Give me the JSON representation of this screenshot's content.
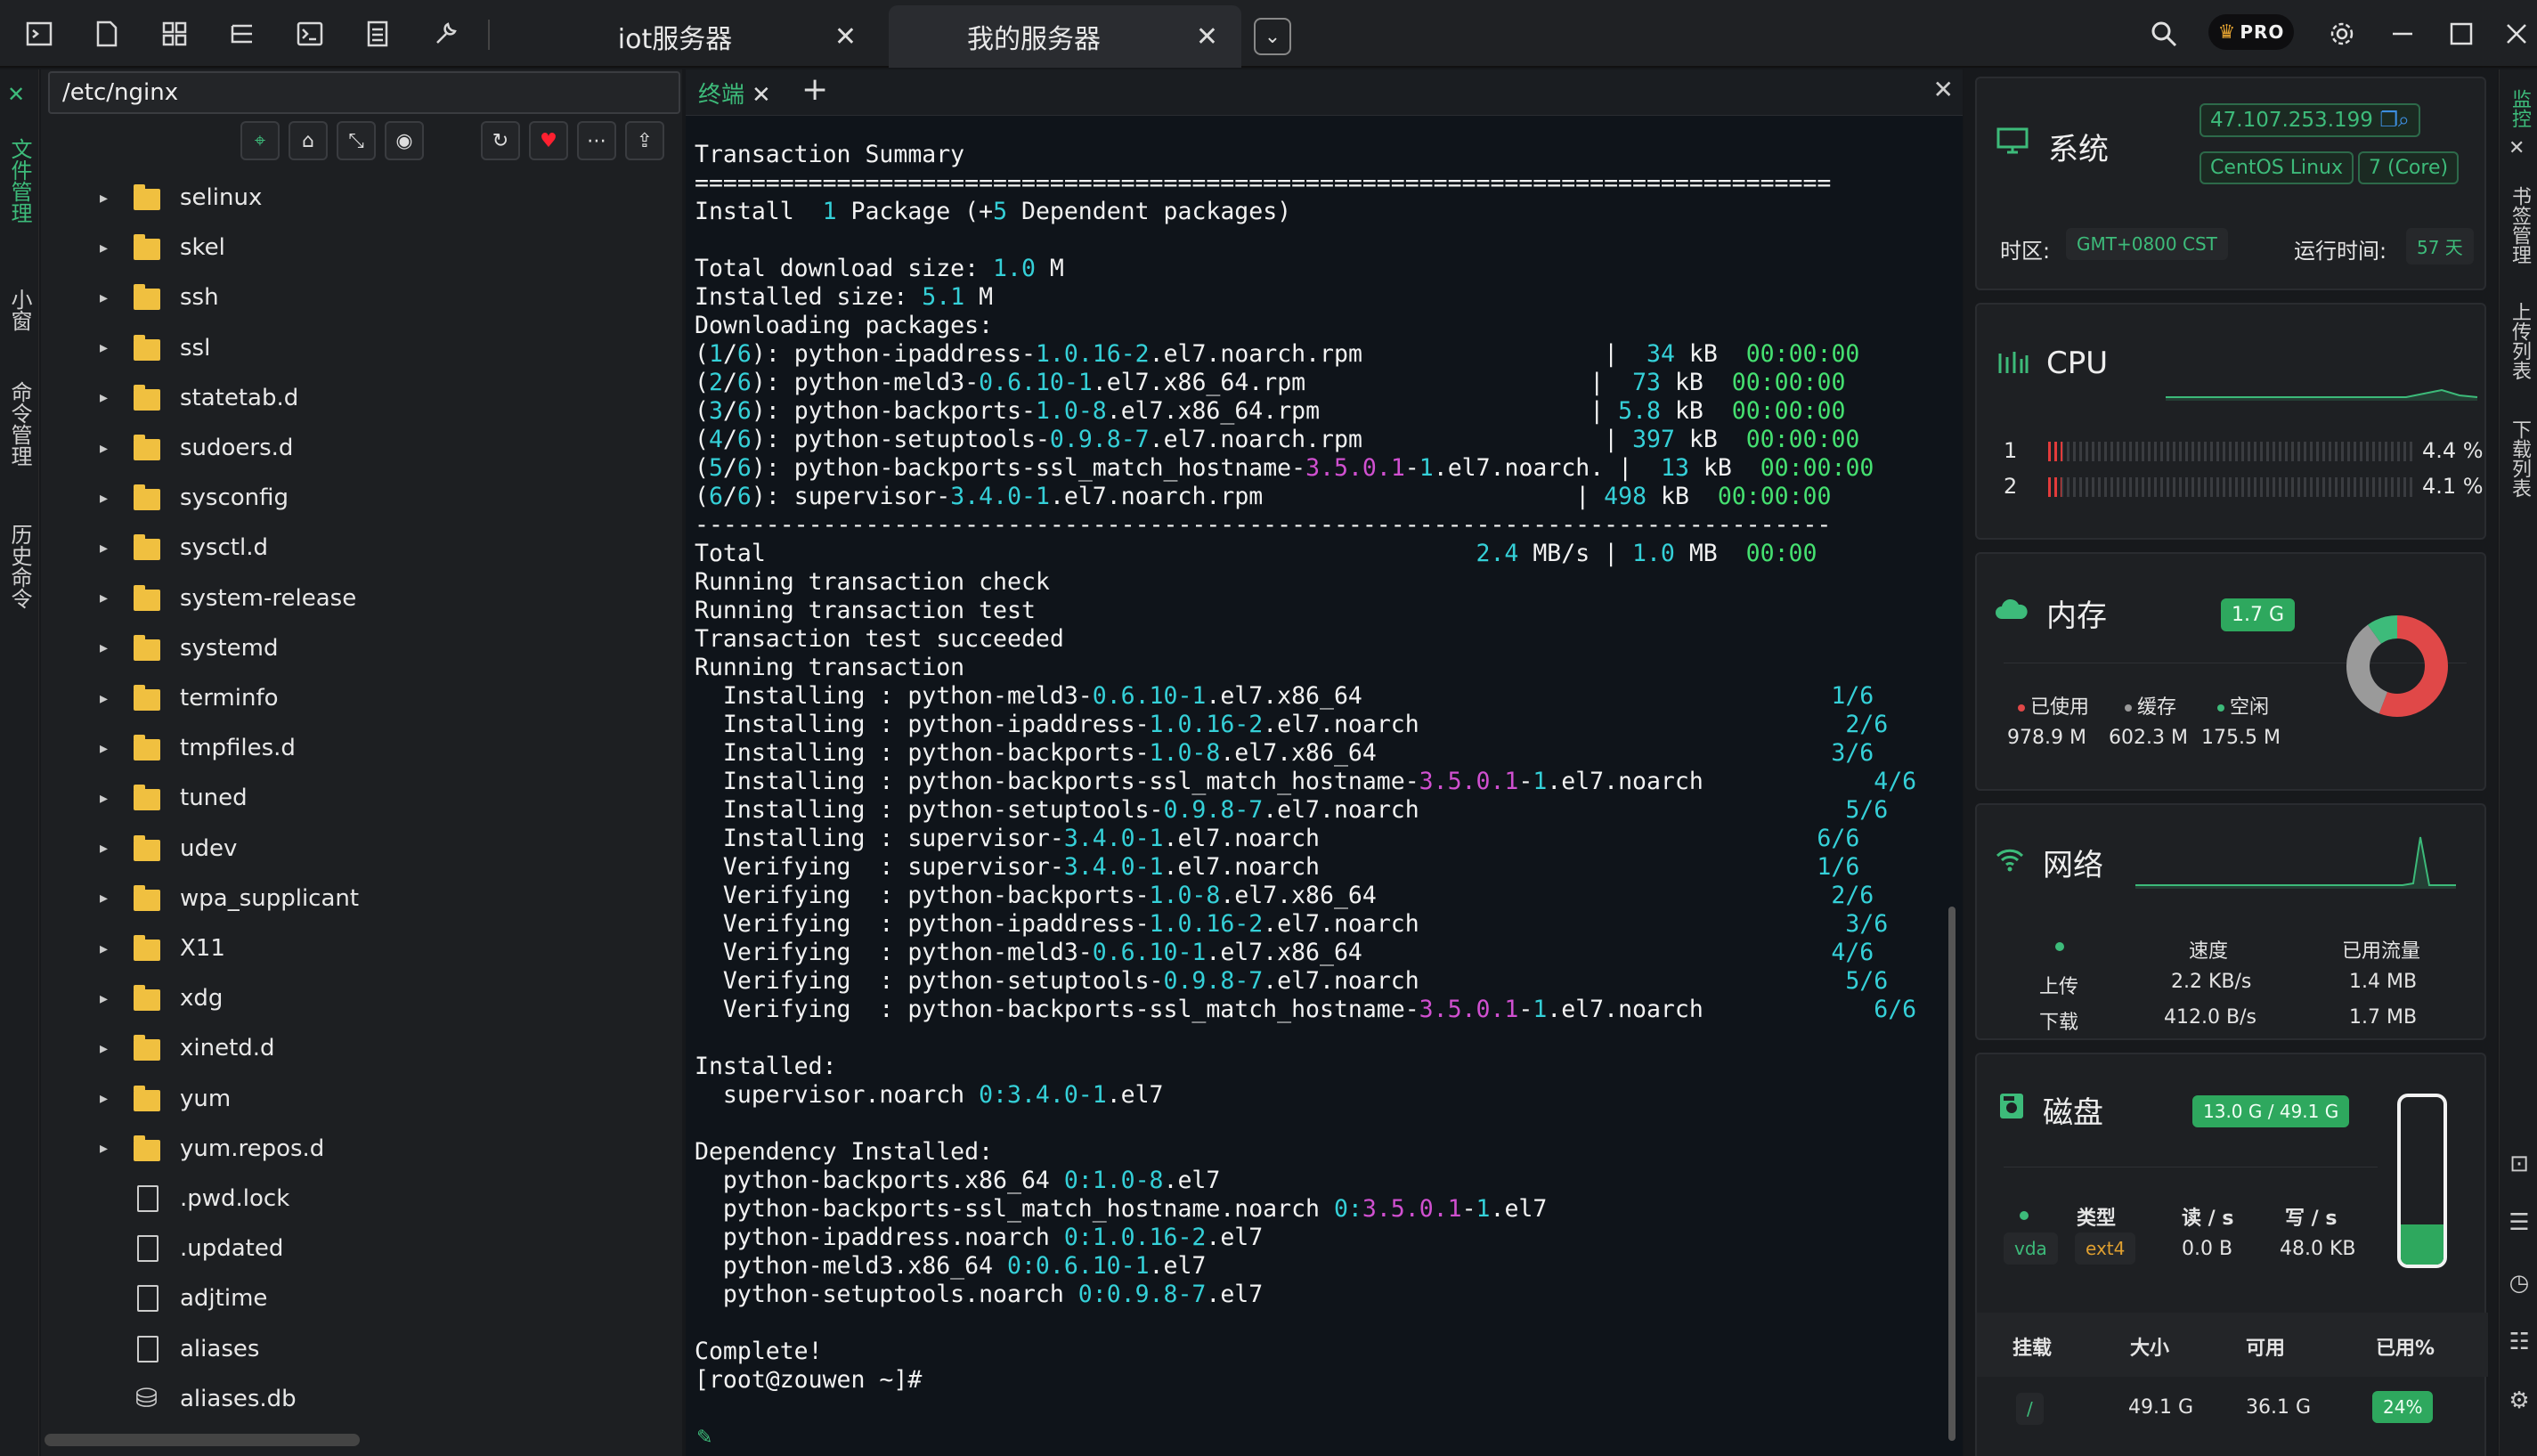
{
  "tabs": [
    {
      "label": "iot服务器",
      "active": false
    },
    {
      "label": "我的服务器",
      "active": true
    }
  ],
  "topbar": {
    "pro_label": "PRO"
  },
  "left_rail": [
    "文件管理",
    "小窗",
    "命令管理",
    "历史命令"
  ],
  "file_panel": {
    "path": "/etc/nginx",
    "items": [
      {
        "name": "selinux",
        "type": "folder"
      },
      {
        "name": "skel",
        "type": "folder"
      },
      {
        "name": "ssh",
        "type": "folder"
      },
      {
        "name": "ssl",
        "type": "folder"
      },
      {
        "name": "statetab.d",
        "type": "folder"
      },
      {
        "name": "sudoers.d",
        "type": "folder"
      },
      {
        "name": "sysconfig",
        "type": "folder"
      },
      {
        "name": "sysctl.d",
        "type": "folder"
      },
      {
        "name": "system-release",
        "type": "folder"
      },
      {
        "name": "systemd",
        "type": "folder"
      },
      {
        "name": "terminfo",
        "type": "folder"
      },
      {
        "name": "tmpfiles.d",
        "type": "folder"
      },
      {
        "name": "tuned",
        "type": "folder"
      },
      {
        "name": "udev",
        "type": "folder"
      },
      {
        "name": "wpa_supplicant",
        "type": "folder"
      },
      {
        "name": "X11",
        "type": "folder"
      },
      {
        "name": "xdg",
        "type": "folder"
      },
      {
        "name": "xinetd.d",
        "type": "folder"
      },
      {
        "name": "yum",
        "type": "folder"
      },
      {
        "name": "yum.repos.d",
        "type": "folder"
      },
      {
        "name": ".pwd.lock",
        "type": "file"
      },
      {
        "name": ".updated",
        "type": "file"
      },
      {
        "name": "adjtime",
        "type": "file"
      },
      {
        "name": "aliases",
        "type": "file"
      },
      {
        "name": "aliases.db",
        "type": "db"
      }
    ]
  },
  "terminal": {
    "tab_label": "终端",
    "lines": [
      [
        [
          "w",
          "Transaction Summary"
        ]
      ],
      [
        [
          "w",
          "================================================================================"
        ]
      ],
      [
        [
          "w",
          "Install  "
        ],
        [
          "c",
          "1"
        ],
        [
          "w",
          " Package (+"
        ],
        [
          "c",
          "5"
        ],
        [
          "w",
          " Dependent packages)"
        ]
      ],
      [
        [
          "w",
          ""
        ]
      ],
      [
        [
          "w",
          "Total download size: "
        ],
        [
          "c",
          "1.0"
        ],
        [
          "w",
          " M"
        ]
      ],
      [
        [
          "w",
          "Installed size: "
        ],
        [
          "c",
          "5.1"
        ],
        [
          "w",
          " M"
        ]
      ],
      [
        [
          "w",
          "Downloading packages:"
        ]
      ],
      [
        [
          "w",
          "("
        ],
        [
          "c",
          "1"
        ],
        [
          "w",
          "/"
        ],
        [
          "c",
          "6"
        ],
        [
          "w",
          "): python-ipaddress-"
        ],
        [
          "c",
          "1.0.16-2"
        ],
        [
          "w",
          ".el7.noarch.rpm                 |  "
        ],
        [
          "c",
          "34"
        ],
        [
          "w",
          " kB  "
        ],
        [
          "g",
          "00:00:00"
        ]
      ],
      [
        [
          "w",
          "("
        ],
        [
          "c",
          "2"
        ],
        [
          "w",
          "/"
        ],
        [
          "c",
          "6"
        ],
        [
          "w",
          "): python-meld3-"
        ],
        [
          "c",
          "0.6.10-1"
        ],
        [
          "w",
          ".el7.x86_64.rpm                    |  "
        ],
        [
          "c",
          "73"
        ],
        [
          "w",
          " kB  "
        ],
        [
          "g",
          "00:00:00"
        ]
      ],
      [
        [
          "w",
          "("
        ],
        [
          "c",
          "3"
        ],
        [
          "w",
          "/"
        ],
        [
          "c",
          "6"
        ],
        [
          "w",
          "): python-backports-"
        ],
        [
          "c",
          "1.0-8"
        ],
        [
          "w",
          ".el7.x86_64.rpm                   | "
        ],
        [
          "c",
          "5.8"
        ],
        [
          "w",
          " kB  "
        ],
        [
          "g",
          "00:00:00"
        ]
      ],
      [
        [
          "w",
          "("
        ],
        [
          "c",
          "4"
        ],
        [
          "w",
          "/"
        ],
        [
          "c",
          "6"
        ],
        [
          "w",
          "): python-setuptools-"
        ],
        [
          "c",
          "0.9.8-7"
        ],
        [
          "w",
          ".el7.noarch.rpm                 | "
        ],
        [
          "c",
          "397"
        ],
        [
          "w",
          " kB  "
        ],
        [
          "g",
          "00:00:00"
        ]
      ],
      [
        [
          "w",
          "("
        ],
        [
          "c",
          "5"
        ],
        [
          "w",
          "/"
        ],
        [
          "c",
          "6"
        ],
        [
          "w",
          "): python-backports-ssl_match_hostname-"
        ],
        [
          "m",
          "3.5.0.1"
        ],
        [
          "w",
          "-"
        ],
        [
          "c",
          "1"
        ],
        [
          "w",
          ".el7.noarch. |  "
        ],
        [
          "c",
          "13"
        ],
        [
          "w",
          " kB  "
        ],
        [
          "g",
          "00:00:00"
        ]
      ],
      [
        [
          "w",
          "("
        ],
        [
          "c",
          "6"
        ],
        [
          "w",
          "/"
        ],
        [
          "c",
          "6"
        ],
        [
          "w",
          "): supervisor-"
        ],
        [
          "c",
          "3.4.0-1"
        ],
        [
          "w",
          ".el7.noarch.rpm                      | "
        ],
        [
          "c",
          "498"
        ],
        [
          "w",
          " kB  "
        ],
        [
          "g",
          "00:00:00"
        ]
      ],
      [
        [
          "w",
          "--------------------------------------------------------------------------------"
        ]
      ],
      [
        [
          "w",
          "Total                                                  "
        ],
        [
          "c",
          "2.4"
        ],
        [
          "w",
          " MB/s | "
        ],
        [
          "c",
          "1.0"
        ],
        [
          "w",
          " MB  "
        ],
        [
          "g",
          "00:00"
        ]
      ],
      [
        [
          "w",
          "Running transaction check"
        ]
      ],
      [
        [
          "w",
          "Running transaction test"
        ]
      ],
      [
        [
          "w",
          "Transaction test succeeded"
        ]
      ],
      [
        [
          "w",
          "Running transaction"
        ]
      ],
      [
        [
          "w",
          "  Installing : python-meld3-"
        ],
        [
          "c",
          "0.6.10-1"
        ],
        [
          "w",
          ".el7.x86_64                                 "
        ],
        [
          "c",
          "1/6"
        ]
      ],
      [
        [
          "w",
          "  Installing : python-ipaddress-"
        ],
        [
          "c",
          "1.0.16-2"
        ],
        [
          "w",
          ".el7.noarch                              "
        ],
        [
          "c",
          "2/6"
        ]
      ],
      [
        [
          "w",
          "  Installing : python-backports-"
        ],
        [
          "c",
          "1.0-8"
        ],
        [
          "w",
          ".el7.x86_64                                "
        ],
        [
          "c",
          "3/6"
        ]
      ],
      [
        [
          "w",
          "  Installing : python-backports-ssl_match_hostname-"
        ],
        [
          "m",
          "3.5.0.1"
        ],
        [
          "w",
          "-"
        ],
        [
          "c",
          "1"
        ],
        [
          "w",
          ".el7.noarch            "
        ],
        [
          "c",
          "4/6"
        ]
      ],
      [
        [
          "w",
          "  Installing : python-setuptools-"
        ],
        [
          "c",
          "0.9.8-7"
        ],
        [
          "w",
          ".el7.noarch                              "
        ],
        [
          "c",
          "5/6"
        ]
      ],
      [
        [
          "w",
          "  Installing : supervisor-"
        ],
        [
          "c",
          "3.4.0-1"
        ],
        [
          "w",
          ".el7.noarch                                   "
        ],
        [
          "c",
          "6/6"
        ]
      ],
      [
        [
          "w",
          "  Verifying  : supervisor-"
        ],
        [
          "c",
          "3.4.0-1"
        ],
        [
          "w",
          ".el7.noarch                                   "
        ],
        [
          "c",
          "1/6"
        ]
      ],
      [
        [
          "w",
          "  Verifying  : python-backports-"
        ],
        [
          "c",
          "1.0-8"
        ],
        [
          "w",
          ".el7.x86_64                                "
        ],
        [
          "c",
          "2/6"
        ]
      ],
      [
        [
          "w",
          "  Verifying  : python-ipaddress-"
        ],
        [
          "c",
          "1.0.16-2"
        ],
        [
          "w",
          ".el7.noarch                              "
        ],
        [
          "c",
          "3/6"
        ]
      ],
      [
        [
          "w",
          "  Verifying  : python-meld3-"
        ],
        [
          "c",
          "0.6.10-1"
        ],
        [
          "w",
          ".el7.x86_64                                 "
        ],
        [
          "c",
          "4/6"
        ]
      ],
      [
        [
          "w",
          "  Verifying  : python-setuptools-"
        ],
        [
          "c",
          "0.9.8-7"
        ],
        [
          "w",
          ".el7.noarch                              "
        ],
        [
          "c",
          "5/6"
        ]
      ],
      [
        [
          "w",
          "  Verifying  : python-backports-ssl_match_hostname-"
        ],
        [
          "m",
          "3.5.0.1"
        ],
        [
          "w",
          "-"
        ],
        [
          "c",
          "1"
        ],
        [
          "w",
          ".el7.noarch            "
        ],
        [
          "c",
          "6/6"
        ]
      ],
      [
        [
          "w",
          ""
        ]
      ],
      [
        [
          "w",
          "Installed:"
        ]
      ],
      [
        [
          "w",
          "  supervisor.noarch "
        ],
        [
          "c",
          "0:3.4.0-1"
        ],
        [
          "w",
          ".el7"
        ]
      ],
      [
        [
          "w",
          ""
        ]
      ],
      [
        [
          "w",
          "Dependency Installed:"
        ]
      ],
      [
        [
          "w",
          "  python-backports.x86_64 "
        ],
        [
          "c",
          "0:1.0-8"
        ],
        [
          "w",
          ".el7"
        ]
      ],
      [
        [
          "w",
          "  python-backports-ssl_match_hostname.noarch "
        ],
        [
          "c",
          "0:"
        ],
        [
          "m",
          "3.5.0.1"
        ],
        [
          "w",
          "-"
        ],
        [
          "c",
          "1"
        ],
        [
          "w",
          ".el7"
        ]
      ],
      [
        [
          "w",
          "  python-ipaddress.noarch "
        ],
        [
          "c",
          "0:1.0.16-2"
        ],
        [
          "w",
          ".el7"
        ]
      ],
      [
        [
          "w",
          "  python-meld3.x86_64 "
        ],
        [
          "c",
          "0:0.6.10-1"
        ],
        [
          "w",
          ".el7"
        ]
      ],
      [
        [
          "w",
          "  python-setuptools.noarch "
        ],
        [
          "c",
          "0:0.9.8-7"
        ],
        [
          "w",
          ".el7"
        ]
      ],
      [
        [
          "w",
          ""
        ]
      ],
      [
        [
          "w",
          "Complete!"
        ]
      ],
      [
        [
          "w",
          "[root@zouwen ~]#"
        ]
      ]
    ]
  },
  "system": {
    "title": "系统",
    "ip": "47.107.253.199",
    "os": "CentOS Linux",
    "core": "7 (Core)",
    "tz_label": "时区:",
    "tz_value": "GMT+0800 CST",
    "uptime_label": "运行时间:",
    "uptime_value": "57 天"
  },
  "cpu": {
    "title": "CPU",
    "cores": [
      {
        "id": "1",
        "percent": 4.4,
        "label": "4.4 %"
      },
      {
        "id": "2",
        "percent": 4.1,
        "label": "4.1 %"
      }
    ]
  },
  "memory": {
    "title": "内存",
    "total": "1.7 G",
    "legend": [
      {
        "label": "已使用",
        "value": "978.9 M",
        "color": "#e04848"
      },
      {
        "label": "缓存",
        "value": "602.3 M",
        "color": "#9a9a9a"
      },
      {
        "label": "空闲",
        "value": "175.5 M",
        "color": "#3dbb7a"
      }
    ],
    "fractions": [
      0.557,
      0.343,
      0.1
    ]
  },
  "network": {
    "title": "网络",
    "col_speed": "速度",
    "col_used": "已用流量",
    "up_label": "上传",
    "down_label": "下载",
    "up_speed": "2.2 KB/s",
    "up_used": "1.4 MB",
    "down_speed": "412.0 B/s",
    "down_used": "1.7 MB"
  },
  "disk": {
    "title": "磁盘",
    "usage": "13.0 G / 49.1 G",
    "usage_fraction": 0.24,
    "h_type": "类型",
    "h_read": "读 / s",
    "h_write": "写 / s",
    "dev": "vda",
    "fs": "ext4",
    "read": "0.0 B",
    "write": "48.0 KB",
    "h_mount": "挂载",
    "h_size": "大小",
    "h_avail": "可用",
    "h_used": "已用%",
    "mount": "/",
    "size": "49.1 G",
    "avail": "36.1 G",
    "used_pct": "24%"
  },
  "right_rail": [
    "监控",
    "书签管理",
    "上传列表",
    "下载列表"
  ],
  "colors": {
    "accent": "#3dbb7a",
    "terminal_bg": "#0f141a",
    "cyan": "#35d0d8",
    "magenta": "#d050d0",
    "green": "#45e070"
  }
}
